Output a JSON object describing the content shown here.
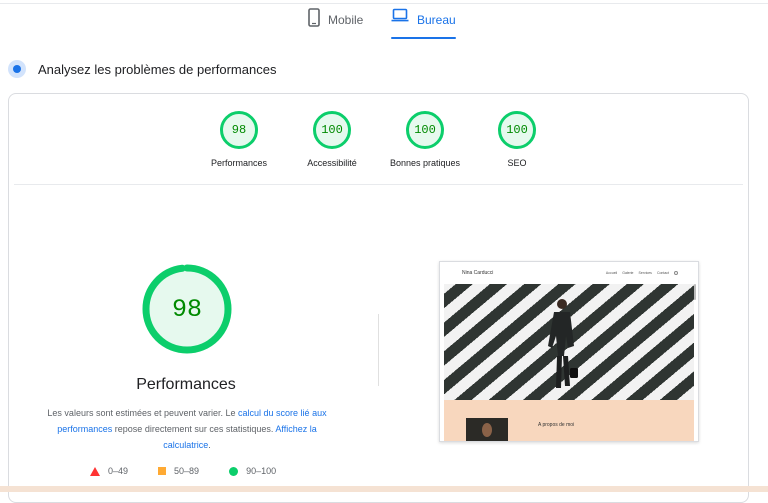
{
  "tabs": {
    "mobile": {
      "label": "Mobile",
      "icon": "smartphone-icon"
    },
    "desktop": {
      "label": "Bureau",
      "icon": "laptop-icon",
      "selected": true
    }
  },
  "heading": "Analysez les problèmes de performances",
  "categories": [
    {
      "score": "98",
      "label": "Performances"
    },
    {
      "score": "100",
      "label": "Accessibilité"
    },
    {
      "score": "100",
      "label": "Bonnes pratiques"
    },
    {
      "score": "100",
      "label": "SEO"
    }
  ],
  "main": {
    "score": "98",
    "score_fraction": 0.98,
    "title": "Performances",
    "desc_prefix": "Les valeurs sont estimées et peuvent varier. Le ",
    "desc_link1": "calcul du score lié aux performances",
    "desc_mid": " repose directement sur ces statistiques. ",
    "desc_link2": "Affichez la calculatrice",
    "desc_suffix": "."
  },
  "legend": [
    {
      "range": "0–49",
      "shape": "triangle",
      "color": "#ff3333"
    },
    {
      "range": "50–89",
      "shape": "square",
      "color": "#ffaa33"
    },
    {
      "range": "90–100",
      "shape": "circle",
      "color": "#0cce6b"
    }
  ],
  "screenshot": {
    "site_name": "Nina Carducci",
    "nav": [
      "Accueil",
      "Galerie",
      "Services",
      "Contact"
    ],
    "section": "A propos de moi"
  },
  "colors": {
    "accent": "#1a73e8",
    "pass": "#0cce6b",
    "pass_text": "#008a00"
  }
}
